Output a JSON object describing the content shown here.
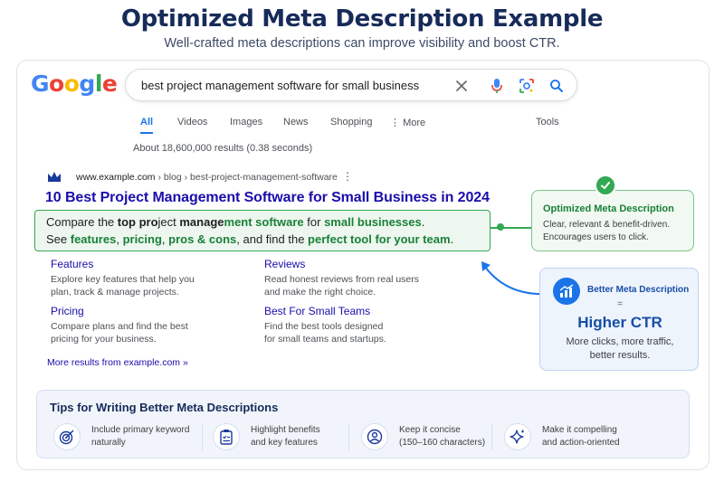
{
  "header": {
    "title": "Optimized Meta Description Example",
    "subtitle": "Well-crafted meta descriptions can improve visibility and boost CTR."
  },
  "google": {
    "logo_letters": [
      "G",
      "o",
      "o",
      "g",
      "l",
      "e"
    ],
    "logo_colors": [
      "#4285F4",
      "#EA4335",
      "#FBBC05",
      "#4285F4",
      "#34A853",
      "#EA4335"
    ],
    "search_query": "best project management software for small business",
    "icons": [
      "close-icon",
      "mic-icon",
      "lens-icon",
      "search-icon"
    ]
  },
  "tabs": {
    "items": [
      "All",
      "Videos",
      "Images",
      "News",
      "Shopping",
      "More"
    ],
    "active": "All",
    "tools": "Tools"
  },
  "result_count": "About 18,600,000 results (0.38 seconds)",
  "result": {
    "site": "www.example.com",
    "path": " › blog › best-project-management-software",
    "title": "10 Best Project Management Software for Small Business in 2024",
    "snippet": {
      "l1_a": "Compare the ",
      "l1_b": "top pro",
      "l1_c": "ject ",
      "l1_d": "manage",
      "l1_e": "ment software",
      "l1_f": " for ",
      "l1_g": "small businesses",
      "l1_h": ".",
      "l2_a": "See ",
      "l2_b": "features",
      "l2_c": ", ",
      "l2_d": "pricing",
      "l2_e": ", ",
      "l2_f": "pros & cons",
      "l2_g": ", and find the ",
      "l2_h": "perfect tool for your team",
      "l2_i": "."
    },
    "sitelinks": [
      {
        "title": "Features",
        "line1": "Explore key features that help you",
        "line2": "plan, track & manage projects."
      },
      {
        "title": "Reviews",
        "line1": "Read honest reviews from real users",
        "line2": "and make the right choice."
      },
      {
        "title": "Pricing",
        "line1": "Compare plans and find the best",
        "line2": "pricing for your business."
      },
      {
        "title": "Best For Small Teams",
        "line1": "Find the best tools designed",
        "line2": "for small teams and startups."
      }
    ],
    "more": "More results from example.com »"
  },
  "callout_green": {
    "title": "Optimized Meta Description",
    "line1": "Clear, relevant & benefit-driven.",
    "line2": "Encourages users to click."
  },
  "callout_blue": {
    "title": "Better Meta Description",
    "equals": "=",
    "big": "Higher CTR",
    "line1": "More clicks, more traffic,",
    "line2": "better results."
  },
  "tips": {
    "title": "Tips for Writing Better Meta Descriptions",
    "items": [
      {
        "icon": "target-icon",
        "line1": "Include primary keyword",
        "line2": "naturally"
      },
      {
        "icon": "checklist-icon",
        "line1": "Highlight benefits",
        "line2": "and key features"
      },
      {
        "icon": "user-icon",
        "line1": "Keep it concise",
        "line2": "(150–160 characters)"
      },
      {
        "icon": "sparkle-icon",
        "line1": "Make it compelling",
        "line2": "and action-oriented"
      }
    ]
  },
  "colors": {
    "title_navy": "#172b5a",
    "link_blue": "#1a0dab",
    "green": "#34a853",
    "accent_blue": "#1a73e8"
  }
}
